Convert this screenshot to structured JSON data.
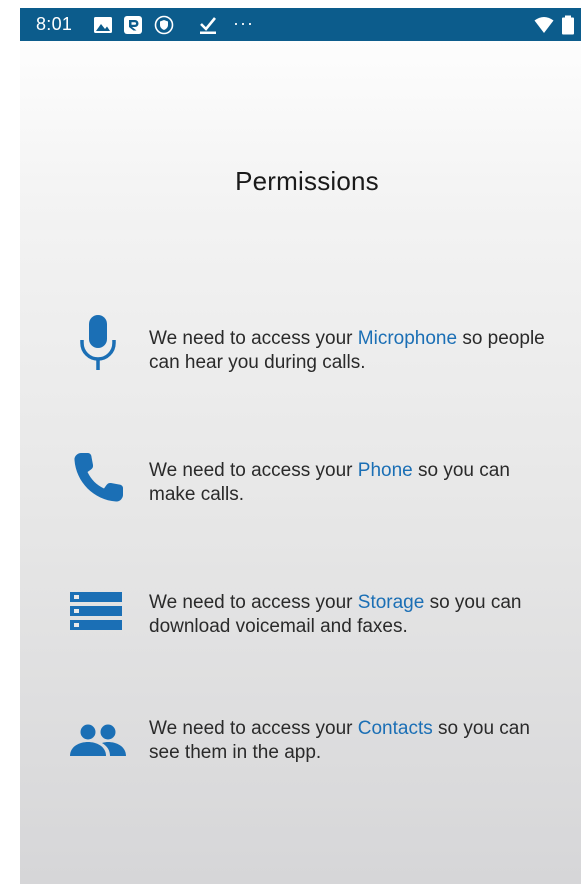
{
  "status_bar": {
    "time": "8:01",
    "left_icons": [
      "image-icon",
      "app-r-icon",
      "shield-icon",
      "download-check-icon"
    ],
    "overflow": "···",
    "right_icons": [
      "wifi-icon",
      "battery-icon"
    ]
  },
  "page": {
    "title": "Permissions"
  },
  "permissions": [
    {
      "icon": "microphone-icon",
      "prefix": "We need to access your ",
      "highlight": "Microphone",
      "suffix": " so people can hear you during calls."
    },
    {
      "icon": "phone-icon",
      "prefix": "We need to access your ",
      "highlight": "Phone",
      "suffix": " so you can make calls."
    },
    {
      "icon": "storage-icon",
      "prefix": "We need to access your ",
      "highlight": "Storage",
      "suffix": " so you can download voicemail and faxes."
    },
    {
      "icon": "contacts-icon",
      "prefix": "We need to access your ",
      "highlight": "Contacts",
      "suffix": " so you can see them in the app."
    }
  ],
  "colors": {
    "status_bar": "#0c5c8c",
    "accent": "#1b6fb5",
    "text": "#2a2a2a"
  }
}
